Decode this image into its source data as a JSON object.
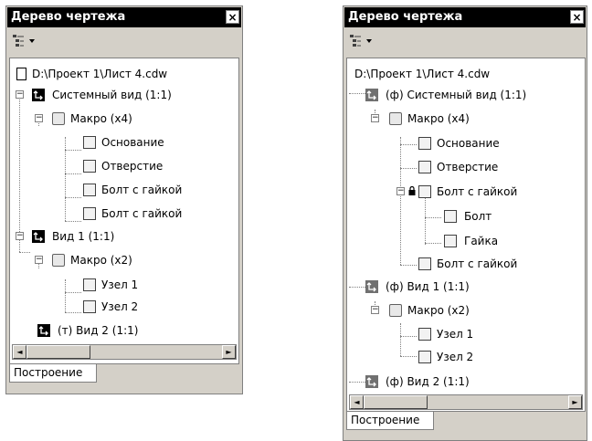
{
  "left_panel": {
    "title": "Дерево чертежа",
    "close_symbol": "×",
    "tab_label": "Построение",
    "tree": {
      "root": "D:\\Проект 1\\Лист 4.cdw",
      "items": [
        "Системный вид (1:1)",
        "Макро (x4)",
        "Основание",
        "Отверстие",
        "Болт с гайкой",
        "Болт с гайкой",
        "Вид 1 (1:1)",
        "Макро (x2)",
        "Узел 1",
        "Узел 2",
        "(т) Вид 2 (1:1)"
      ]
    },
    "scroll_left": "◄",
    "scroll_right": "►"
  },
  "right_panel": {
    "title": "Дерево чертежа",
    "close_symbol": "×",
    "tab_label": "Построение",
    "tree": {
      "root": "D:\\Проект 1\\Лист 4.cdw",
      "items": [
        "(ф) Системный вид (1:1)",
        "Макро (x4)",
        "Основание",
        "Отверстие",
        "Болт с гайкой",
        "Болт",
        "Гайка",
        "Болт с гайкой",
        "(ф) Вид 1 (1:1)",
        "Макро (x2)",
        "Узел 1",
        "Узел 2",
        "(ф) Вид 2 (1:1)"
      ]
    },
    "scroll_left": "◄",
    "scroll_right": "►"
  }
}
